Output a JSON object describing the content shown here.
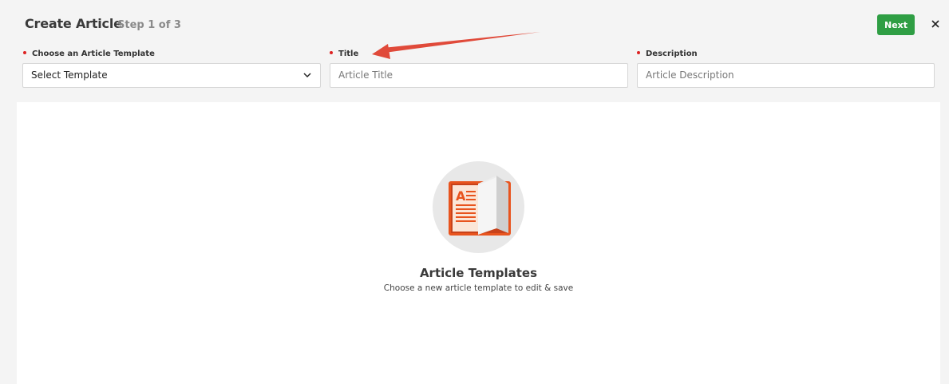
{
  "header": {
    "title": "Create Article",
    "step": "Step 1 of 3",
    "next_label": "Next",
    "close_icon": "close-icon"
  },
  "form": {
    "template": {
      "label": "Choose an Article Template",
      "value": "Select Template"
    },
    "title": {
      "label": "Title",
      "placeholder": "Article Title"
    },
    "description": {
      "label": "Description",
      "placeholder": "Article Description"
    }
  },
  "empty_state": {
    "icon": "article-book-icon",
    "title": "Article Templates",
    "subtitle": "Choose a new article template to edit & save"
  },
  "colors": {
    "accent_green": "#2f9e44",
    "required_dot": "#dd2222",
    "annotation_arrow": "#e04a3a",
    "book_orange": "#e8541e"
  }
}
